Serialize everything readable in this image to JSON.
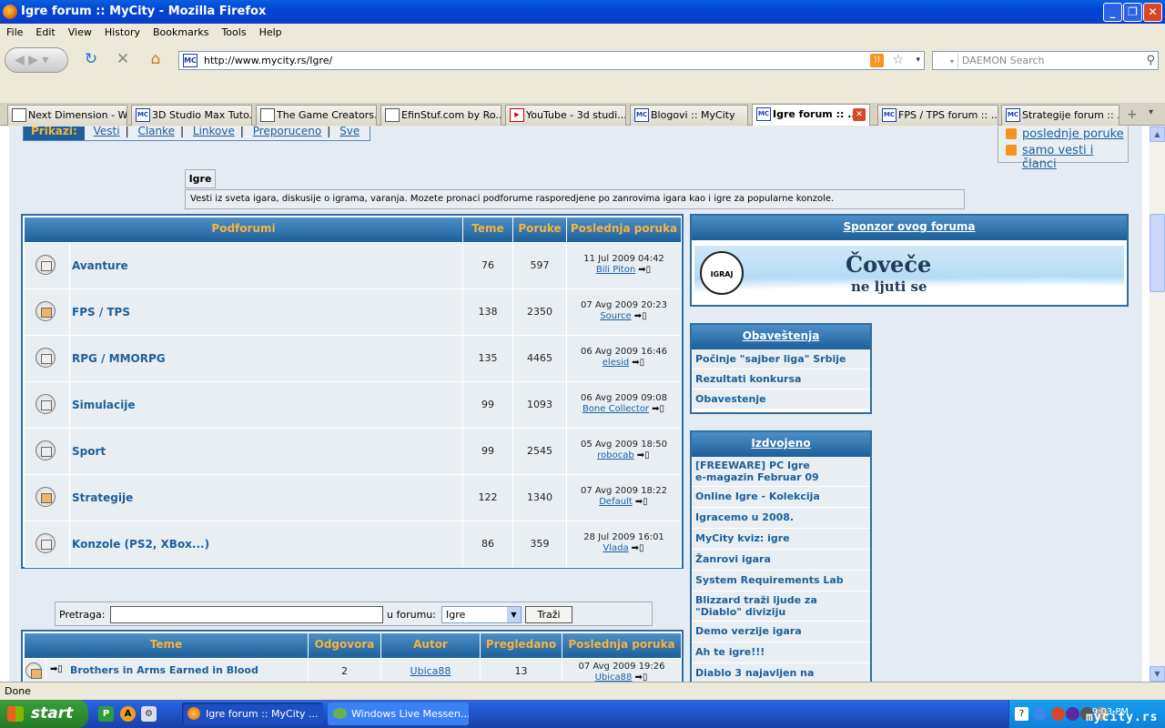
{
  "window": {
    "title": "Igre forum :: MyCity - Mozilla Firefox"
  },
  "menu": [
    "File",
    "Edit",
    "View",
    "History",
    "Bookmarks",
    "Tools",
    "Help"
  ],
  "url": "http://www.mycity.rs/Igre/",
  "search_placeholder": "DAEMON Search",
  "tabs": [
    {
      "label": "Next Dimension - W...",
      "icon": "page"
    },
    {
      "label": "3D Studio Max Tuto...",
      "icon": "mc"
    },
    {
      "label": "The Game Creators...",
      "icon": "page"
    },
    {
      "label": "EfinStuf.com by Ro...",
      "icon": "page"
    },
    {
      "label": "YouTube - 3d studi...",
      "icon": "yt"
    },
    {
      "label": "Blogovi :: MyCity",
      "icon": "mc"
    },
    {
      "label": "Igre forum :: ...",
      "icon": "mc",
      "active": true
    },
    {
      "label": "FPS / TPS forum :: ...",
      "icon": "mc"
    },
    {
      "label": "Strategije forum :: ...",
      "icon": "mc"
    }
  ],
  "topnav": {
    "items": [
      "Prikazi:",
      "Vesti",
      "Clanke",
      "Linkove",
      "Preporuceno",
      "Sve"
    ]
  },
  "rss": {
    "a": "poslednje poruke",
    "b": "samo vesti i članci"
  },
  "forum_box": {
    "title": "Igre",
    "desc": "Vesti iz sveta igara, diskusije o igrama, varanja. Mozete pronaci podforume rasporedjene po zanrovima igara kao i igre za popularne konzole."
  },
  "subforums": {
    "headers": {
      "name": "Podforumi",
      "topics": "Teme",
      "posts": "Poruke",
      "last": "Poslednja poruka"
    },
    "rows": [
      {
        "name": "Avanture",
        "topics": "76",
        "posts": "597",
        "date": "11 Jul 2009 04:42",
        "user": "Bili Piton",
        "new": false
      },
      {
        "name": "FPS / TPS",
        "topics": "138",
        "posts": "2350",
        "date": "07 Avg 2009 20:23",
        "user": "Source",
        "new": true
      },
      {
        "name": "RPG / MMORPG",
        "topics": "135",
        "posts": "4465",
        "date": "06 Avg 2009 16:46",
        "user": "elesid",
        "new": false
      },
      {
        "name": "Simulacije",
        "topics": "99",
        "posts": "1093",
        "date": "06 Avg 2009 09:08",
        "user": "Bone Collector",
        "new": false
      },
      {
        "name": "Sport",
        "topics": "99",
        "posts": "2545",
        "date": "05 Avg 2009 18:50",
        "user": "robocab",
        "new": false
      },
      {
        "name": "Strategije",
        "topics": "122",
        "posts": "1340",
        "date": "07 Avg 2009 18:22",
        "user": "Default",
        "new": true
      },
      {
        "name": "Konzole (PS2, XBox...)",
        "topics": "86",
        "posts": "359",
        "date": "28 Jul 2009 16:01",
        "user": "Vlada",
        "new": false
      }
    ]
  },
  "searchform": {
    "label": "Pretraga:",
    "in_label": "u forumu:",
    "select": "Igre",
    "button": "Traži"
  },
  "topics": {
    "headers": {
      "topic": "Teme",
      "replies": "Odgovora",
      "author": "Autor",
      "views": "Pregledano",
      "last": "Poslednja poruka"
    },
    "rows": [
      {
        "name": "Brothers in Arms Earned in Blood",
        "replies": "2",
        "author": "Ubica88",
        "views": "13",
        "date": "07 Avg 2009 19:26",
        "user": "Ubica88"
      }
    ]
  },
  "sponsor": {
    "title": "Sponzor ovog foruma",
    "banner_line1": "Čoveče",
    "banner_line2": "ne ljuti se"
  },
  "notices": {
    "title": "Obaveštenja",
    "items": [
      "Počinje \"sajber liga\" Srbije",
      "Rezultati konkursa",
      "Obavestenje"
    ]
  },
  "featured": {
    "title": "Izdvojeno",
    "items": [
      "[FREEWARE] PC Igre\ne-magazin Februar 09",
      "Online Igre - Kolekcija",
      "Igracemo u 2008.",
      "MyCity kviz: igre",
      "Žanrovi igara",
      "System Requirements Lab",
      "Blizzard traži ljude za\n\"Diablo\" diviziju",
      "Demo verzije igara",
      "Ah te igre!!!",
      "Diablo 3 najavljen na"
    ]
  },
  "status": "Done",
  "taskbar": {
    "start": "start",
    "buttons": [
      "Igre forum :: MyCity ...",
      "Windows Live Messen..."
    ],
    "clock": "9:03 PM",
    "watermark": "mycity.rs"
  }
}
